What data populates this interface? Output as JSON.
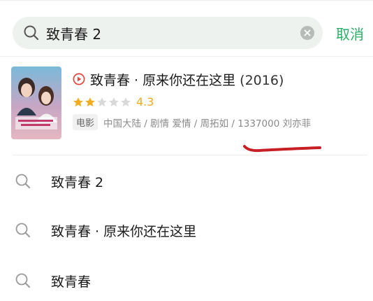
{
  "search": {
    "query": "致青春 2",
    "cancel_label": "取消",
    "icon": "search-icon",
    "clear_icon": "clear-icon"
  },
  "result": {
    "title": "致青春 · 原来你还在这里",
    "year": "(2016)",
    "rating": "4.3",
    "rating_stars": 2,
    "rating_max": 5,
    "type": "电影",
    "meta": "中国大陆 / 剧情 爱情 / 周拓如 / 1337000 刘亦菲",
    "play_icon": "play-circle-icon",
    "accent_color": "#e2473d",
    "star_color": "#f0ad1e"
  },
  "suggestions": [
    {
      "label": "致青春 2"
    },
    {
      "label": "致青春 · 原来你还在这里"
    },
    {
      "label": "致青春"
    }
  ],
  "colors": {
    "accent": "#2aae67",
    "search_bg": "#eef2ef",
    "annotation": "#c81f26"
  }
}
